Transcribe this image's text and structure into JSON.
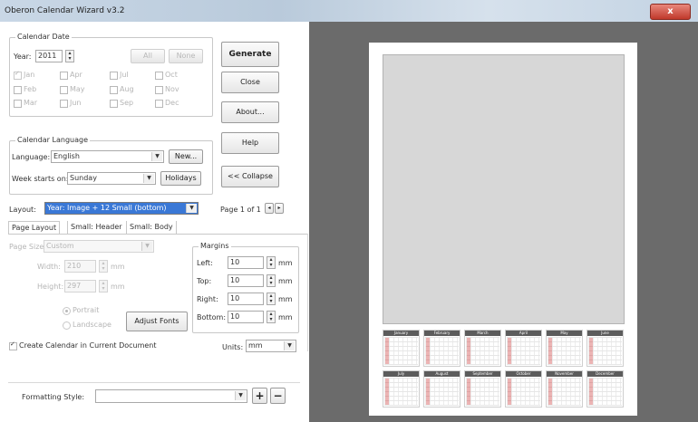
{
  "window": {
    "title": "Oberon Calendar Wizard v3.2",
    "close_glyph": "x"
  },
  "calendar_date": {
    "legend": "Calendar Date",
    "year_label": "Year:",
    "year_value": "2011",
    "all_label": "All",
    "none_label": "None",
    "months": [
      {
        "label": "Jan",
        "checked": true
      },
      {
        "label": "Apr",
        "checked": false
      },
      {
        "label": "Jul",
        "checked": false
      },
      {
        "label": "Oct",
        "checked": false
      },
      {
        "label": "Feb",
        "checked": false
      },
      {
        "label": "May",
        "checked": false
      },
      {
        "label": "Aug",
        "checked": false
      },
      {
        "label": "Nov",
        "checked": false
      },
      {
        "label": "Mar",
        "checked": false
      },
      {
        "label": "Jun",
        "checked": false
      },
      {
        "label": "Sep",
        "checked": false
      },
      {
        "label": "Dec",
        "checked": false
      }
    ]
  },
  "buttons": {
    "generate": "Generate",
    "close": "Close",
    "about": "About...",
    "help": "Help",
    "collapse": "<< Collapse",
    "new": "New...",
    "holidays": "Holidays",
    "adjust_fonts": "Adjust Fonts"
  },
  "calendar_language": {
    "legend": "Calendar Language",
    "language_label": "Language:",
    "language_value": "English",
    "week_label": "Week starts on:",
    "week_value": "Sunday"
  },
  "layout": {
    "label": "Layout:",
    "value": "Year: Image + 12 Small (bottom)",
    "page_text": "Page 1 of 1"
  },
  "tabs": [
    "Page Layout",
    "Small: Header",
    "Small: Body"
  ],
  "page_layout": {
    "page_size_label": "Page Size:",
    "page_size_value": "Custom",
    "width_label": "Width:",
    "width_value": "210",
    "height_label": "Height:",
    "height_value": "297",
    "unit_mm": "mm",
    "portrait_label": "Portrait",
    "landscape_label": "Landscape"
  },
  "margins": {
    "legend": "Margins",
    "left_label": "Left:",
    "left_value": "10",
    "top_label": "Top:",
    "top_value": "10",
    "right_label": "Right:",
    "right_value": "10",
    "bottom_label": "Bottom:",
    "bottom_value": "10",
    "unit": "mm"
  },
  "create_in_current_label": "Create Calendar in Current Document",
  "create_in_current_checked": true,
  "units": {
    "label": "Units:",
    "value": "mm"
  },
  "formatting": {
    "label": "Formatting Style:",
    "value": "",
    "add": "+",
    "remove": "−"
  },
  "preview_months": [
    "January",
    "February",
    "March",
    "April",
    "May",
    "June",
    "July",
    "August",
    "September",
    "October",
    "November",
    "December"
  ]
}
